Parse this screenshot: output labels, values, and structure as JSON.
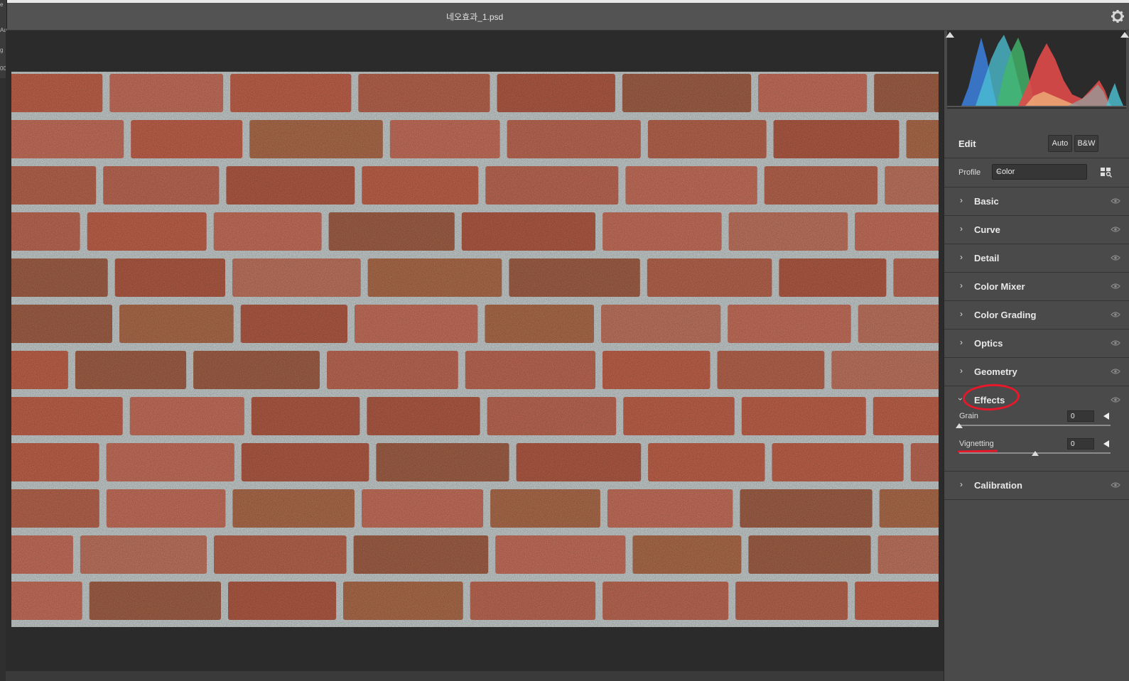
{
  "window": {
    "title": "네오효과_1.psd",
    "settings_icon": "gear-icon"
  },
  "left_strip": [
    "e",
    "Au",
    "g",
    "00"
  ],
  "panel": {
    "edit": {
      "label": "Edit",
      "auto_label": "Auto",
      "bw_label": "B&W"
    },
    "profile": {
      "label": "Profile",
      "value": "Color",
      "browse_icon": "profile-browser-icon"
    },
    "sections": [
      {
        "label": "Basic",
        "expanded": false
      },
      {
        "label": "Curve",
        "expanded": false
      },
      {
        "label": "Detail",
        "expanded": false
      },
      {
        "label": "Color Mixer",
        "expanded": false
      },
      {
        "label": "Color Grading",
        "expanded": false
      },
      {
        "label": "Optics",
        "expanded": false
      },
      {
        "label": "Geometry",
        "expanded": false
      },
      {
        "label": "Effects",
        "expanded": true
      },
      {
        "label": "Calibration",
        "expanded": false
      }
    ],
    "effects": {
      "grain": {
        "label": "Grain",
        "value": "0",
        "slider_fraction": 0.0
      },
      "vignetting": {
        "label": "Vignetting",
        "value": "0",
        "slider_fraction": 0.5
      }
    }
  },
  "annotations": {
    "highlight_color": "#e8182b"
  },
  "photo": {
    "subject": "brick wall",
    "brick_color": "#c86a52",
    "mortar_color": "#cfd6d6"
  }
}
